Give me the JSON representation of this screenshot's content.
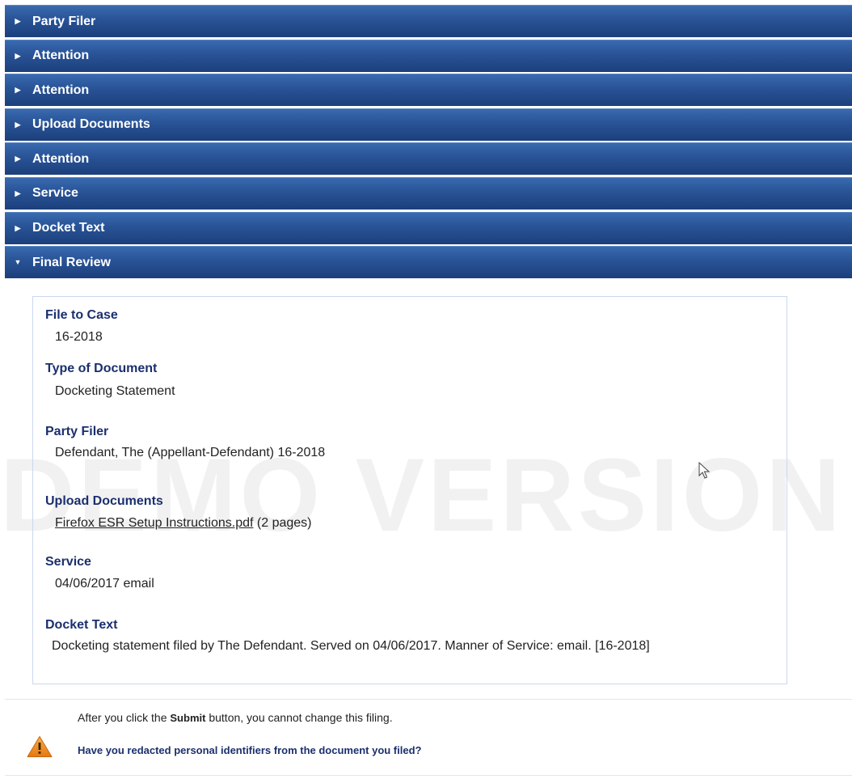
{
  "accordion": {
    "sections": [
      {
        "label": "Party Filer",
        "expanded": false
      },
      {
        "label": "Attention",
        "expanded": false
      },
      {
        "label": "Attention",
        "expanded": false
      },
      {
        "label": "Upload Documents",
        "expanded": false
      },
      {
        "label": "Attention",
        "expanded": false
      },
      {
        "label": "Service",
        "expanded": false
      },
      {
        "label": "Docket Text",
        "expanded": false
      },
      {
        "label": "Final Review",
        "expanded": true
      }
    ]
  },
  "review": {
    "file_to_case": {
      "label": "File to Case",
      "value": "16-2018"
    },
    "type_of_document": {
      "label": "Type of Document",
      "value": "Docketing Statement"
    },
    "party_filer": {
      "label": "Party Filer",
      "value": "Defendant, The (Appellant-Defendant) 16-2018"
    },
    "upload_documents": {
      "label": "Upload Documents",
      "file_name": "Firefox ESR Setup Instructions.pdf",
      "pages": " (2 pages)"
    },
    "service": {
      "label": "Service",
      "value": "04/06/2017 email"
    },
    "docket_text": {
      "label": "Docket Text",
      "value": "Docketing statement filed by The Defendant. Served on 04/06/2017. Manner of Service: email. [16-2018]"
    }
  },
  "watermark": "DEMO VERSION",
  "notice": {
    "prefix": "After you click the ",
    "button_word": "Submit",
    "suffix": " button, you cannot change this filing.",
    "question": "Have you redacted personal identifiers from the document you filed?"
  },
  "icons": {
    "section_collapsed": "caret-right-icon",
    "section_expanded": "caret-down-icon",
    "warning": "warning-icon",
    "cursor": "mouse-cursor-icon"
  },
  "colors": {
    "header_top": "#3a6ab0",
    "header_bottom": "#1c3f7c",
    "label_navy": "#1b2f6e",
    "warning_orange": "#f0891e"
  }
}
